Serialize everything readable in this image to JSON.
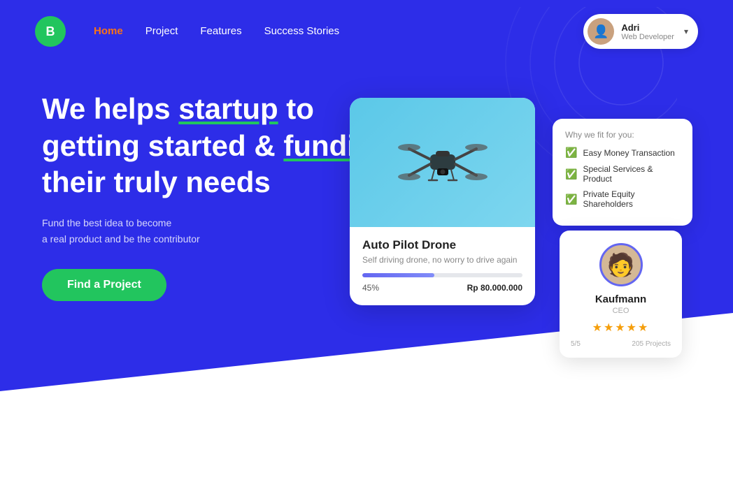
{
  "logo": {
    "letter": "B"
  },
  "nav": {
    "links": [
      {
        "label": "Home",
        "active": true
      },
      {
        "label": "Project",
        "active": false
      },
      {
        "label": "Features",
        "active": false
      },
      {
        "label": "Success Stories",
        "active": false
      }
    ]
  },
  "user": {
    "name": "Adri",
    "role": "Web Developer"
  },
  "hero": {
    "headline_prefix": "We helps ",
    "headline_startup": "startup",
    "headline_middle": " to getting started & ",
    "headline_funding": "funding",
    "headline_suffix": " their truly needs",
    "subtitle_line1": "Fund the best idea to become",
    "subtitle_line2": "a real product and be the contributor",
    "cta_label": "Find a Project"
  },
  "project_card": {
    "title": "Auto Pilot Drone",
    "description": "Self driving drone, no worry to drive again",
    "progress_percent": 45,
    "progress_label": "45%",
    "amount": "Rp 80.000.000"
  },
  "why_fit": {
    "title": "Why we fit for you:",
    "items": [
      "Easy Money Transaction",
      "Special Services & Product",
      "Private Equity Shareholders"
    ]
  },
  "person": {
    "name": "Kaufmann",
    "role": "CEO",
    "rating": 5,
    "score": "5/5",
    "projects": "205 Projects",
    "stars": "★★★★★"
  }
}
